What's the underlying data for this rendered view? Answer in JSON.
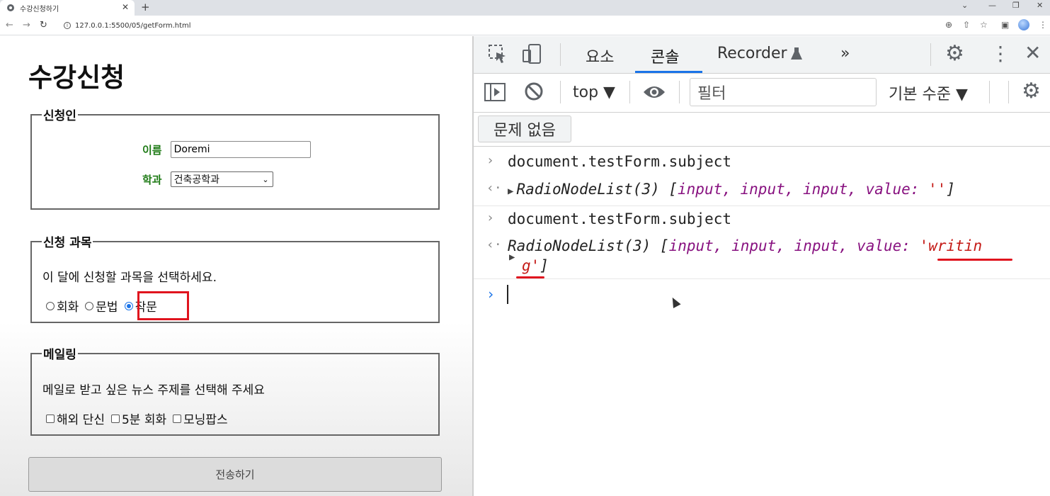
{
  "browser": {
    "tab_title": "수강신청하기",
    "tab_close": "✕",
    "new_tab": "+",
    "url": "127.0.0.1:5500/05/getForm.html",
    "window_controls": [
      "⌄",
      "—",
      "❐",
      "✕"
    ],
    "nav": {
      "back": "←",
      "forward": "→",
      "reload": "↻"
    },
    "addr_icons": [
      "zoom-icon",
      "share-icon",
      "star-icon",
      "sidebar-icon",
      "profile-avatar",
      "menu-icon"
    ]
  },
  "page": {
    "title": "수강신청",
    "applicant": {
      "legend": "신청인",
      "name_label": "이름",
      "name_value": "Doremi",
      "dept_label": "학과",
      "dept_selected": "건축공학과"
    },
    "subjects": {
      "legend": "신청 과목",
      "description": "이 달에 신청할 과목을 선택하세요.",
      "options": [
        "회화",
        "문법",
        "작문"
      ],
      "selected": "작문"
    },
    "mailing": {
      "legend": "메일링",
      "description": "메일로 받고 싶은 뉴스 주제를 선택해 주세요",
      "options": [
        "해외 단신",
        "5분 회화",
        "모닝팝스"
      ]
    },
    "submit_label": "전송하기"
  },
  "devtools": {
    "tabs": [
      "요소",
      "콘솔",
      "Recorder",
      "»"
    ],
    "active_tab": "콘솔",
    "context": "top ▼",
    "filter_placeholder": "필터",
    "level": "기본 수준 ▼",
    "issues": "문제 없음",
    "console": [
      {
        "type": "input",
        "text": "document.testForm.subject"
      },
      {
        "type": "result",
        "prefix": "RadioNodeList(3) [",
        "items": "input, input, input",
        "value_label": ", value: ",
        "value": "''",
        "suffix": "]"
      },
      {
        "type": "input",
        "text": "document.testForm.subject"
      },
      {
        "type": "result",
        "prefix": "RadioNodeList(3) [",
        "items": "input, input, input",
        "value_label": ", value: ",
        "value_part1": "'writin",
        "value_part2": "g'",
        "suffix": "]"
      }
    ],
    "prompt": "›"
  },
  "colors": {
    "label_green": "#1d7a14",
    "highlight_red": "#e0141e",
    "devtools_blue": "#1a73e8",
    "purple_token": "#881280",
    "string_red": "#c41a16"
  }
}
